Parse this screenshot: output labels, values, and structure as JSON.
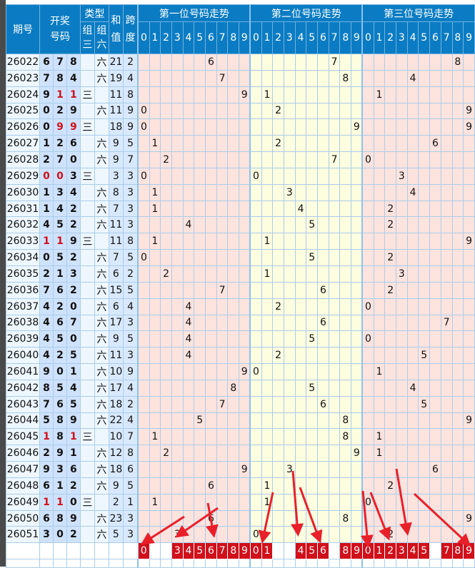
{
  "header": {
    "period": "期号",
    "draw_numbers": "开奖号码",
    "type": "类型",
    "type_group3": "组三",
    "type_group6": "组六",
    "sum": "和值",
    "span": "跨度",
    "trend_titles": [
      "第一位号码走势",
      "第二位号码走势",
      "第三位号码走势"
    ],
    "digits": [
      "0",
      "1",
      "2",
      "3",
      "4",
      "5",
      "6",
      "7",
      "8",
      "9"
    ]
  },
  "type_marks": {
    "group3": "三",
    "group6": "六"
  },
  "rows": [
    {
      "period": "26022",
      "digits": [
        6,
        7,
        8
      ],
      "type": "六",
      "sum": 21,
      "span": 2
    },
    {
      "period": "26023",
      "digits": [
        7,
        8,
        4
      ],
      "type": "六",
      "sum": 19,
      "span": 4
    },
    {
      "period": "26024",
      "digits": [
        9,
        1,
        1
      ],
      "type": "三",
      "sum": 11,
      "span": 8
    },
    {
      "period": "26025",
      "digits": [
        0,
        2,
        9
      ],
      "type": "六",
      "sum": 11,
      "span": 9
    },
    {
      "period": "26026",
      "digits": [
        0,
        9,
        9
      ],
      "type": "三",
      "sum": 18,
      "span": 9
    },
    {
      "period": "26027",
      "digits": [
        1,
        2,
        6
      ],
      "type": "六",
      "sum": 9,
      "span": 5
    },
    {
      "period": "26028",
      "digits": [
        2,
        7,
        0
      ],
      "type": "六",
      "sum": 9,
      "span": 7
    },
    {
      "period": "26029",
      "digits": [
        0,
        0,
        3
      ],
      "type": "三",
      "sum": 3,
      "span": 3
    },
    {
      "period": "26030",
      "digits": [
        1,
        3,
        4
      ],
      "type": "六",
      "sum": 8,
      "span": 3
    },
    {
      "period": "26031",
      "digits": [
        1,
        4,
        2
      ],
      "type": "六",
      "sum": 7,
      "span": 3
    },
    {
      "period": "26032",
      "digits": [
        4,
        5,
        2
      ],
      "type": "六",
      "sum": 11,
      "span": 3
    },
    {
      "period": "26033",
      "digits": [
        1,
        1,
        9
      ],
      "type": "三",
      "sum": 11,
      "span": 8
    },
    {
      "period": "26034",
      "digits": [
        0,
        5,
        2
      ],
      "type": "六",
      "sum": 7,
      "span": 5
    },
    {
      "period": "26035",
      "digits": [
        2,
        1,
        3
      ],
      "type": "六",
      "sum": 6,
      "span": 2
    },
    {
      "period": "26036",
      "digits": [
        7,
        6,
        2
      ],
      "type": "六",
      "sum": 15,
      "span": 5
    },
    {
      "period": "26037",
      "digits": [
        4,
        2,
        0
      ],
      "type": "六",
      "sum": 6,
      "span": 4
    },
    {
      "period": "26038",
      "digits": [
        4,
        6,
        7
      ],
      "type": "六",
      "sum": 17,
      "span": 3
    },
    {
      "period": "26039",
      "digits": [
        4,
        5,
        0
      ],
      "type": "六",
      "sum": 9,
      "span": 5
    },
    {
      "period": "26040",
      "digits": [
        4,
        2,
        5
      ],
      "type": "六",
      "sum": 11,
      "span": 3
    },
    {
      "period": "26041",
      "digits": [
        9,
        0,
        1
      ],
      "type": "六",
      "sum": 10,
      "span": 9
    },
    {
      "period": "26042",
      "digits": [
        8,
        5,
        4
      ],
      "type": "六",
      "sum": 17,
      "span": 4
    },
    {
      "period": "26043",
      "digits": [
        7,
        6,
        5
      ],
      "type": "六",
      "sum": 18,
      "span": 2
    },
    {
      "period": "26044",
      "digits": [
        5,
        8,
        9
      ],
      "type": "六",
      "sum": 22,
      "span": 4
    },
    {
      "period": "26045",
      "digits": [
        1,
        8,
        1
      ],
      "type": "三",
      "sum": 10,
      "span": 7
    },
    {
      "period": "26046",
      "digits": [
        2,
        9,
        1
      ],
      "type": "六",
      "sum": 12,
      "span": 8
    },
    {
      "period": "26047",
      "digits": [
        9,
        3,
        6
      ],
      "type": "六",
      "sum": 18,
      "span": 6
    },
    {
      "period": "26048",
      "digits": [
        6,
        1,
        2
      ],
      "type": "六",
      "sum": 9,
      "span": 5
    },
    {
      "period": "26049",
      "digits": [
        1,
        1,
        0
      ],
      "type": "三",
      "sum": 2,
      "span": 1
    },
    {
      "period": "26050",
      "digits": [
        6,
        8,
        9
      ],
      "type": "六",
      "sum": 23,
      "span": 3
    },
    {
      "period": "26051",
      "digits": [
        3,
        0,
        2
      ],
      "type": "六",
      "sum": 5,
      "span": 3
    }
  ],
  "highlighted_digits": [
    [
      0,
      3,
      4,
      5,
      6,
      7,
      8,
      9
    ],
    [
      0,
      1,
      4,
      5,
      6,
      8,
      9
    ],
    [
      0,
      1,
      2,
      3,
      4,
      5,
      7,
      8,
      9
    ]
  ],
  "colors": {
    "header": "#0b7cc3",
    "pair_digit": "#d0111b",
    "digit": "#16308e",
    "highlight": "#d0101b",
    "arrow": "#e8202a"
  }
}
